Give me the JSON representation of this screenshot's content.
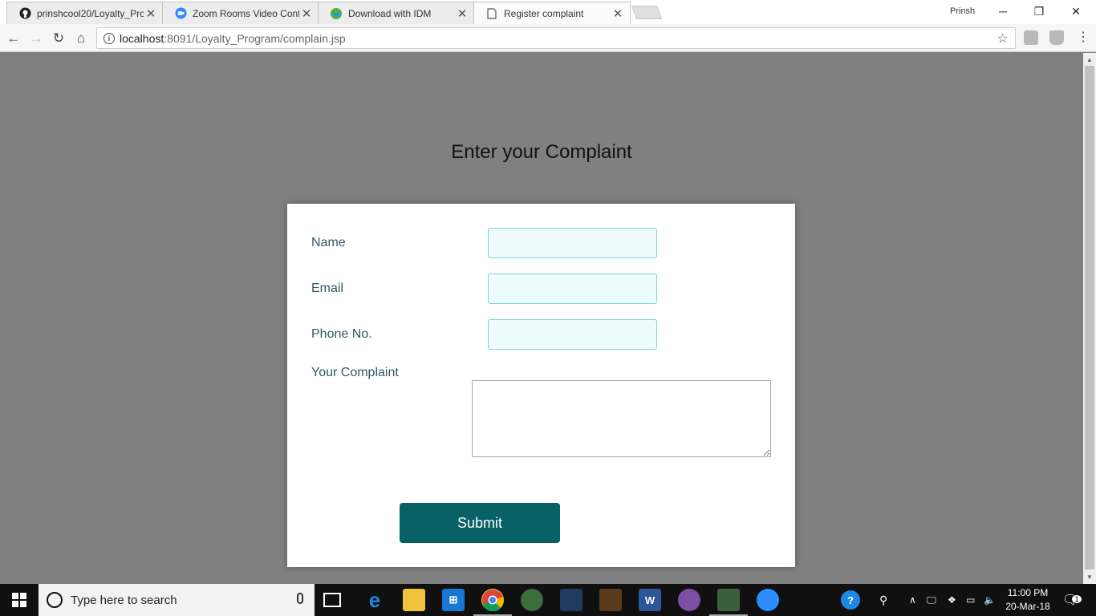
{
  "browser": {
    "tabs": [
      {
        "title": "prinshcool20/Loyalty_Pro",
        "icon": "github-icon",
        "active": false
      },
      {
        "title": "Zoom Rooms Video Conf",
        "icon": "zoom-icon",
        "active": false
      },
      {
        "title": "Download with IDM",
        "icon": "idm-icon",
        "active": false
      },
      {
        "title": "Register complaint",
        "icon": "page-icon",
        "active": true
      }
    ],
    "profile_name": "Prinsh",
    "url_host": "localhost",
    "url_path": ":8091/Loyalty_Program/complain.jsp"
  },
  "page": {
    "heading": "Enter your Complaint",
    "form": {
      "name_label": "Name",
      "email_label": "Email",
      "phone_label": "Phone No.",
      "complaint_label": "Your Complaint",
      "name_value": "",
      "email_value": "",
      "phone_value": "",
      "complaint_value": "",
      "submit_label": "Submit"
    }
  },
  "taskbar": {
    "search_placeholder": "Type here to search",
    "time": "11:00 PM",
    "date": "20-Mar-18",
    "notification_count": "1"
  },
  "colors": {
    "page_background": "#808080",
    "submit_button": "#086166",
    "label_text": "#2c5a63",
    "input_background": "#eefcfb",
    "input_border": "#7ed3d7"
  }
}
